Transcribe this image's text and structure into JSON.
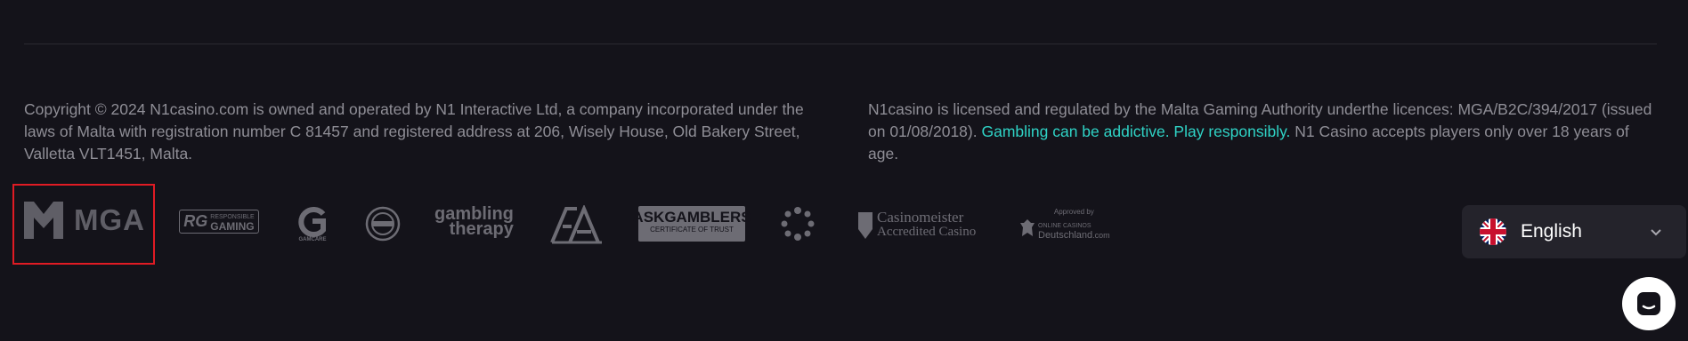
{
  "footer": {
    "copyright": "Copyright © 2024 N1casino.com is owned and operated by N1 Interactive Ltd, a company incorporated under the laws of Malta with registration number C 81457 and registered address at 206, Wisely House, Old Bakery Street, Valletta VLT1451, Malta.",
    "license_prefix": "N1casino is licensed and regulated by the Malta Gaming Authority underthe licences: MGA/B2C/394/2017 (issued on 01/08/2018). ",
    "license_highlight": "Gambling can be addictive. Play responsibly.",
    "license_suffix": " N1 Casino accepts players only over 18 years of age."
  },
  "logos": {
    "mga": "MGA",
    "rg_small": "RESPONSIBLE",
    "rg_big": "GAMING",
    "gamcare": "GAMCARE",
    "gt_line1": "gambling",
    "gt_line2": "therapy",
    "ga": "GA",
    "askgamblers": "ASKGAMBLERS",
    "askgamblers_sub": "CERTIFICATE OF TRUST",
    "casinomeister": "Casinomeister",
    "casinomeister_sub": "Accredited Casino",
    "ocd_approved": "Approved by",
    "ocd_line1": "ONLINE CASINOS",
    "ocd_line2": "Deutschland",
    "ocd_line2_suffix": ".com"
  },
  "language": {
    "label": "English",
    "flag": "uk-flag-icon"
  },
  "colors": {
    "background": "#14131a",
    "accent": "#2fd3c6",
    "highlight_border": "#e01b24"
  }
}
